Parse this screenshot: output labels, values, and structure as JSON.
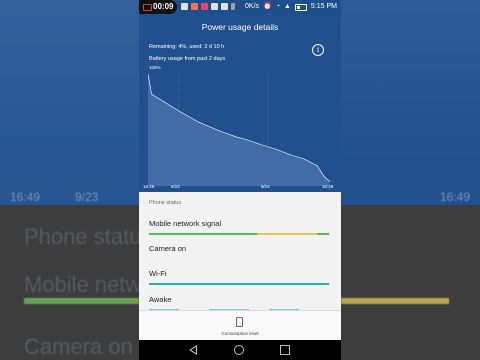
{
  "status_bar": {
    "recording_time": "00:09",
    "network_speed": "0K/s",
    "clock": "5:15 PM"
  },
  "header": {
    "title": "Power usage details",
    "remaining": "Remaining: 4%, used: 2 d 10 h",
    "usage_label": "Battery usage from past 2 days",
    "percent_label": "100%"
  },
  "chart_data": {
    "type": "area",
    "title": "Battery usage from past 2 days",
    "x_ticks": [
      "16:49",
      "9/23",
      "9/24",
      "16:49"
    ],
    "y_max_label": "100%",
    "x": [
      0,
      0.02,
      0.06,
      0.12,
      0.18,
      0.28,
      0.38,
      0.48,
      0.55,
      0.62,
      0.7,
      0.78,
      0.86,
      0.93,
      0.97,
      1.0
    ],
    "values": [
      100,
      82,
      78,
      72,
      66,
      57,
      50,
      44,
      41,
      37,
      33,
      28,
      24,
      18,
      8,
      4
    ],
    "ylim": [
      0,
      100
    ],
    "colors": {
      "fill": "#4a73ad",
      "line": "#ffffff",
      "background": "#21508f"
    }
  },
  "phone_status": {
    "section_title": "Phone status",
    "rows": [
      {
        "label": "Mobile network signal",
        "bar_colors": [
          "#5cb85c",
          "#e8c254"
        ]
      },
      {
        "label": "Camera on",
        "bar_colors": []
      },
      {
        "label": "Wi-Fi",
        "bar_colors": [
          "#26b5ad"
        ]
      },
      {
        "label": "Awake",
        "bar_colors": [
          "#26b5ad"
        ]
      }
    ]
  },
  "bottom": {
    "consumption_label": "Consumption level"
  },
  "background": {
    "phone_status": "Phone status",
    "mobile_network": "Mobile networ",
    "camera_on": "Camera on",
    "tick_left": "16:49",
    "tick_date": "9/23",
    "tick_right": "16:49"
  }
}
